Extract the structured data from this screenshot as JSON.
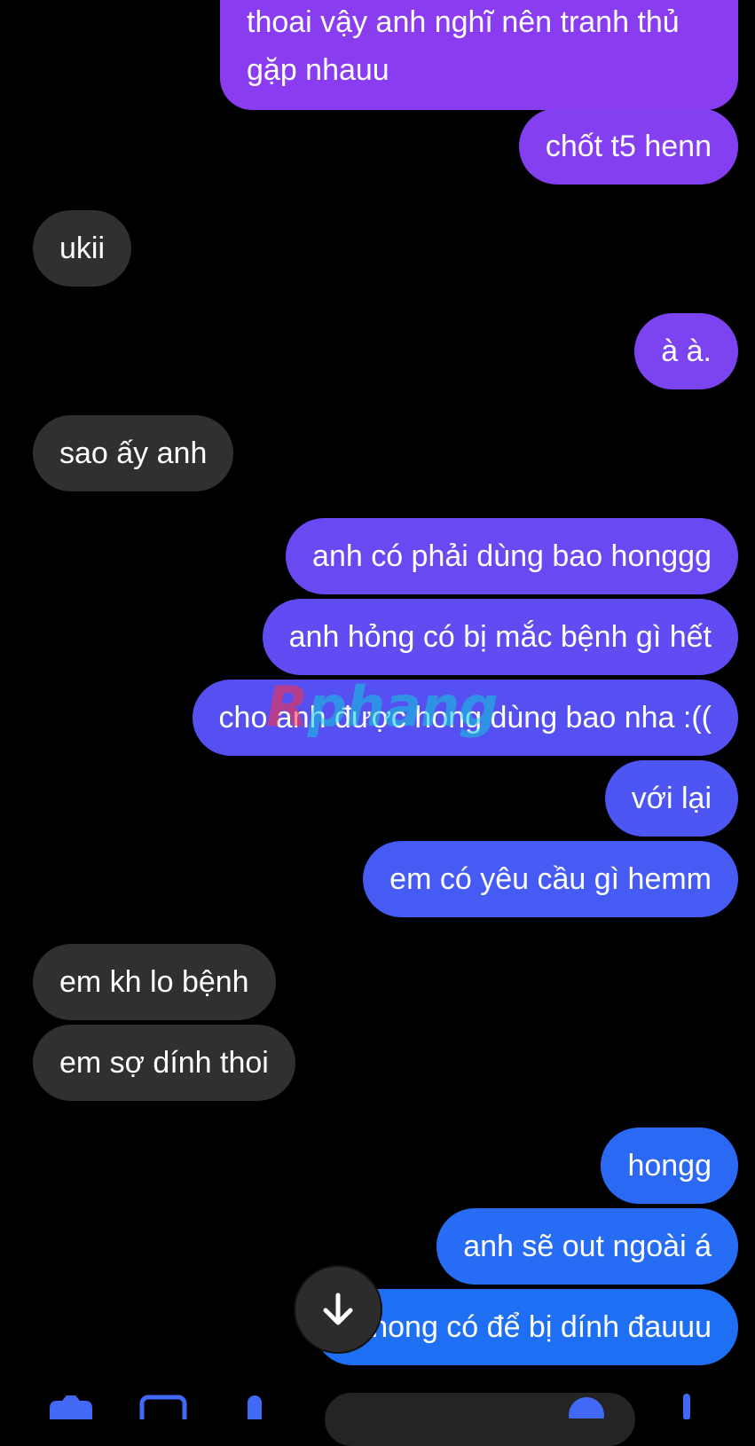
{
  "messages": [
    {
      "side": "out",
      "lines": [
        "thoai vậy anh nghĩ nên tranh thủ",
        "gặp nhauu"
      ]
    },
    {
      "side": "out",
      "text": "chốt t5 henn"
    },
    {
      "side": "in",
      "text": "ukii"
    },
    {
      "side": "out",
      "text": "à à."
    },
    {
      "side": "in",
      "text": "sao ấy anh"
    },
    {
      "side": "out",
      "text": "anh có phải dùng bao honggg"
    },
    {
      "side": "out",
      "text": "anh hỏng có bị mắc bệnh gì hết"
    },
    {
      "side": "out",
      "text": "cho anh được hong dùng bao nha :(("
    },
    {
      "side": "out",
      "text": "với lại"
    },
    {
      "side": "out",
      "text": "em có yêu cầu gì hemm"
    },
    {
      "side": "in",
      "text": "em kh lo bệnh"
    },
    {
      "side": "in",
      "text": "em sợ dính thoi"
    },
    {
      "side": "out",
      "text": "hongg"
    },
    {
      "side": "out",
      "text": "anh sẽ out ngoài á"
    },
    {
      "side": "out",
      "text": "hong có để bị dính đauuu"
    }
  ],
  "watermark": {
    "first": "R",
    "rest": "phang"
  },
  "colors": {
    "incoming": "#303030",
    "gradient_top": "#8a3cf0",
    "gradient_mid": "#5b49f2",
    "gradient_bottom": "#1f6ff5",
    "background": "#000000"
  },
  "icons": {
    "scroll": "arrow-down-icon",
    "bottom_bar": [
      "camera-icon",
      "image-icon",
      "mic-icon",
      "emoji-icon",
      "like-icon"
    ]
  }
}
